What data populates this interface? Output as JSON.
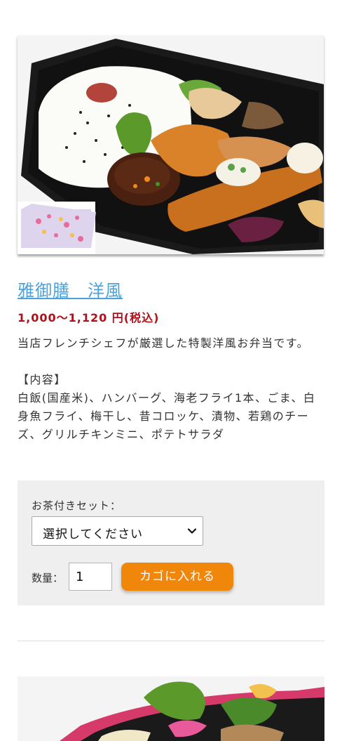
{
  "product": {
    "title": "雅御膳　洋風",
    "price": "1,000～1,120 円(税込)",
    "description": "当店フレンチシェフが厳選した特製洋風お弁当です。\n\n【内容】\n白飯(国産米)、ハンバーグ、海老フライ1本、ごま、白身魚フライ、梅干し、昔コロッケ、漬物、若鶏のチーズ、グリルチキンミニ、ポテトサラダ"
  },
  "order": {
    "option_label": "お茶付きセット：",
    "option_selected": "選択してください",
    "quantity_label": "数量：",
    "quantity_value": "1",
    "cart_button_label": "カゴに入れる"
  },
  "colors": {
    "title_link": "#4aa3df",
    "price": "#b0101a",
    "cart_button": "#f0860a",
    "order_box_bg": "#efefef"
  }
}
